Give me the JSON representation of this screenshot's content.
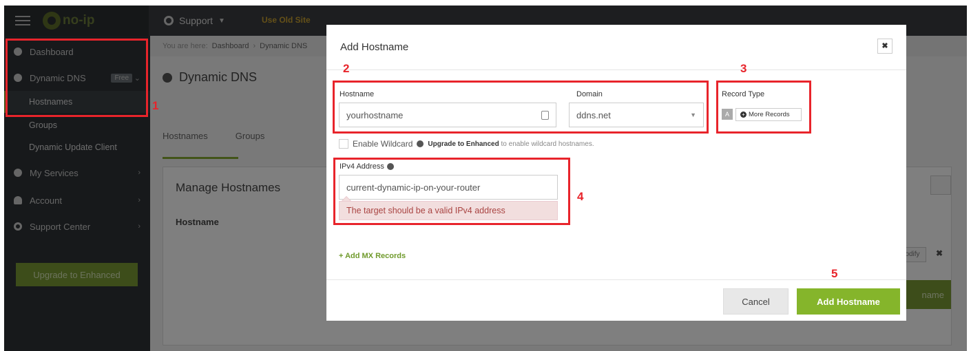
{
  "topbar": {
    "logo_text": "no-ip",
    "support_label": "Support",
    "old_site_label": "Use Old Site"
  },
  "sidebar": {
    "dashboard": "Dashboard",
    "dynamic_dns": "Dynamic DNS",
    "free_badge": "Free",
    "hostnames": "Hostnames",
    "groups": "Groups",
    "dynamic_update_client": "Dynamic Update Client",
    "my_services": "My Services",
    "account": "Account",
    "support_center": "Support Center",
    "upgrade_button": "Upgrade to Enhanced"
  },
  "content": {
    "breadcrumb_prefix": "You are here:",
    "breadcrumb_1": "Dashboard",
    "breadcrumb_sep": "›",
    "breadcrumb_2": "Dynamic DNS",
    "page_title": "Dynamic DNS",
    "tab_hostnames": "Hostnames",
    "tab_groups": "Groups",
    "panel_title": "Manage Hostnames",
    "column_hostname": "Hostname",
    "modify_button": "odify",
    "delete_glyph": "✖",
    "add_hostname_bg": "name"
  },
  "modal": {
    "title": "Add Hostname",
    "close_glyph": "✖",
    "hostname_label": "Hostname",
    "hostname_value": "yourhostname",
    "domain_label": "Domain",
    "domain_value": "ddns.net",
    "domain_caret": "▼",
    "record_type_label": "Record Type",
    "record_a": "A",
    "more_records": "More Records",
    "wildcard_label": "Enable Wildcard",
    "wildcard_upgrade": "Upgrade to Enhanced",
    "wildcard_note": "to enable wildcard hostnames.",
    "ipv4_label": "IPv4 Address",
    "ipv4_value": "current-dynamic-ip-on-your-router",
    "ipv4_error": "The target should be a valid IPv4 address",
    "mx_link": "+ Add MX Records",
    "cancel_button": "Cancel",
    "add_button": "Add Hostname"
  },
  "annotations": [
    "1",
    "2",
    "3",
    "4",
    "5"
  ],
  "colors": {
    "accent_green": "#85b52b",
    "callout_red": "#e8242b",
    "error_bg": "#f2dede",
    "sidebar_bg": "#2e3236"
  },
  "icons": [
    "hamburger-icon",
    "logo-icon",
    "lifebuoy-icon",
    "dashboard-icon",
    "globe-icon",
    "gear-icon",
    "user-icon",
    "support-icon",
    "search-icon",
    "keyboard-icon",
    "info-icon",
    "plus-circle-icon",
    "close-icon"
  ]
}
